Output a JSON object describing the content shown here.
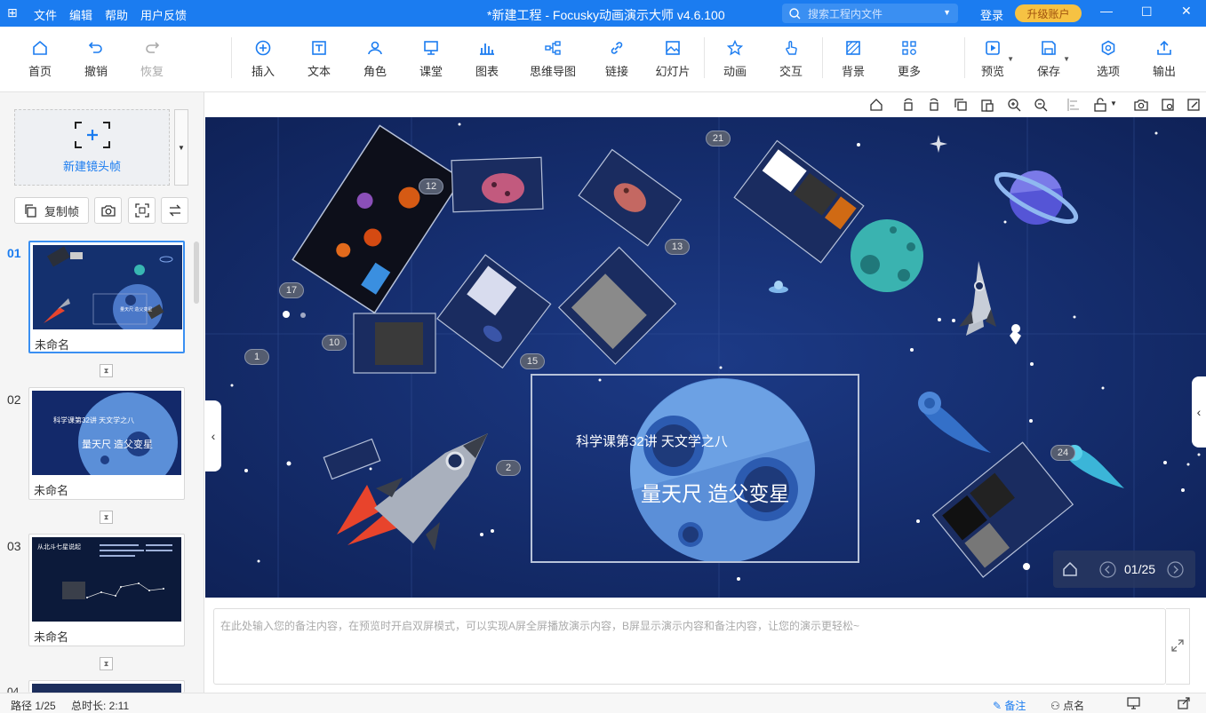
{
  "app": {
    "title": "*新建工程 - Focusky动画演示大师  v4.6.100",
    "menu": [
      "文件",
      "编辑",
      "帮助",
      "用户反馈"
    ],
    "search_placeholder": "搜索工程内文件",
    "login": "登录",
    "upgrade": "升级账户"
  },
  "toolbar": {
    "home": "首页",
    "undo": "撤销",
    "redo": "恢复",
    "insert": "插入",
    "text": "文本",
    "role": "角色",
    "classroom": "课堂",
    "chart": "图表",
    "mindmap": "思维导图",
    "link": "链接",
    "slide": "幻灯片",
    "animation": "动画",
    "interact": "交互",
    "background": "背景",
    "more": "更多",
    "preview": "预览",
    "save": "保存",
    "options": "选项",
    "export": "输出"
  },
  "left": {
    "new_frame": "新建镜头帧",
    "copy_frame": "复制帧",
    "slides": [
      {
        "num": "01",
        "name": "未命名"
      },
      {
        "num": "02",
        "name": "未命名"
      },
      {
        "num": "03",
        "name": "未命名"
      },
      {
        "num": "04",
        "name": ""
      }
    ]
  },
  "thumbs": {
    "s2_line1": "科学课第32讲  天文学之八",
    "s2_line2": "量天尺 造父变星",
    "s3_title": "从北斗七星说起"
  },
  "canvas": {
    "title_line1": "科学课第32讲  天文学之八",
    "title_line2": "量天尺 造父变星",
    "labels": [
      "1",
      "2",
      "10",
      "12",
      "13",
      "15",
      "17",
      "21",
      "24"
    ],
    "nav": "01/25",
    "colors": {
      "bg": "#13296a",
      "planet": "#5b8fd8",
      "rocket_flame": "#e8442c"
    }
  },
  "notes": {
    "placeholder": "在此处输入您的备注内容，在预览时开启双屏模式，可以实现A屏全屏播放演示内容，B屏显示演示内容和备注内容，让您的演示更轻松~"
  },
  "status": {
    "path": "路径 1/25",
    "duration": "总时长: 2:11",
    "notes_tab": "备注",
    "rollcall": "点名"
  }
}
